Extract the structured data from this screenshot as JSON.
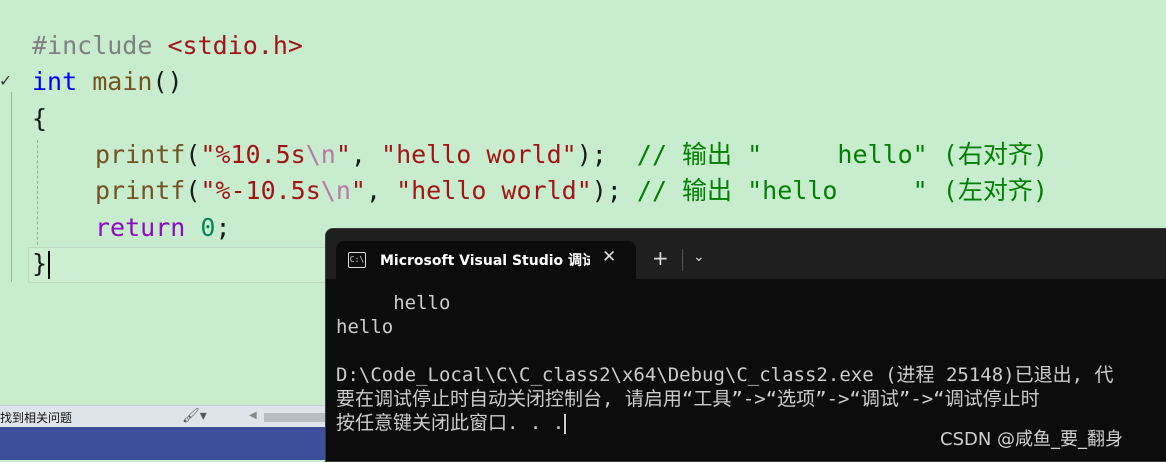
{
  "editor": {
    "line1": {
      "directive": "#include",
      "header": "<stdio.h>"
    },
    "line2": {
      "type": "int",
      "fn": "main",
      "parens": "()"
    },
    "line3": "{",
    "line4": {
      "fn": "printf",
      "open": "(",
      "str_a": "\"%10.5s",
      "esc": "\\n",
      "str_b": "\"",
      "sep": ", ",
      "arg": "\"hello world\"",
      "close": ");  ",
      "comment": "// 输出 \"     hello\" (右对齐)"
    },
    "line5": {
      "fn": "printf",
      "open": "(",
      "str_a": "\"%-10.5s",
      "esc": "\\n",
      "str_b": "\"",
      "sep": ", ",
      "arg": "\"hello world\"",
      "close": "); ",
      "comment": "// 输出 \"hello     \" (左对齐)"
    },
    "line6": {
      "kw": "return",
      "space": " ",
      "num": "0",
      "semi": ";"
    },
    "line7": "}"
  },
  "statusbar": {
    "issues_label": "找到相关问题"
  },
  "terminal": {
    "tab_title": "Microsoft Visual Studio 调试控制台",
    "tab_icon_text": "C:\\",
    "add_tab": "+",
    "close_tab": "✕",
    "dropdown": "⌄",
    "output": [
      "     hello",
      "hello",
      "",
      "D:\\Code_Local\\C\\C_class2\\x64\\Debug\\C_class2.exe (进程 25148)已退出, 代",
      "要在调试停止时自动关闭控制台, 请启用“工具”->“选项”->“调试”->“调试停止时",
      "按任意键关闭此窗口. . ."
    ]
  },
  "watermark": "CSDN @咸鱼_要_翻身"
}
